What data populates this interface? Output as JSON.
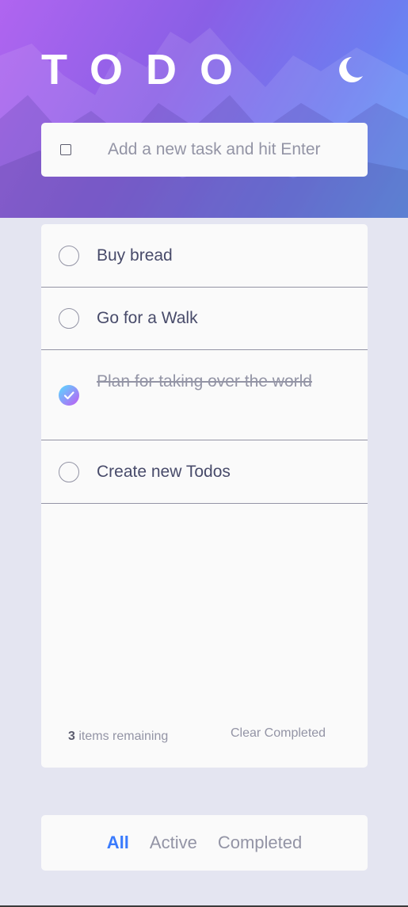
{
  "header": {
    "title": "TODO",
    "theme_toggle_icon": "moon-icon"
  },
  "new_task": {
    "placeholder": "Add a new task and hit Enter",
    "value": ""
  },
  "todos": [
    {
      "text": "Buy bread",
      "completed": false
    },
    {
      "text": "Go for a Walk",
      "completed": false
    },
    {
      "text": "Plan for taking over the world",
      "completed": true
    },
    {
      "text": "Create new Todos",
      "completed": false
    }
  ],
  "footer": {
    "remaining_count": "3",
    "remaining_label": " items remaining",
    "clear_label": "Clear Completed"
  },
  "filters": {
    "all": "All",
    "active": "Active",
    "completed": "Completed",
    "selected": "All"
  },
  "colors": {
    "accent": "#3a7bfd",
    "check_gradient_start": "#57ddff",
    "check_gradient_end": "#c058f3",
    "page_background": "#e4e5f1",
    "card_background": "#fafafa"
  }
}
